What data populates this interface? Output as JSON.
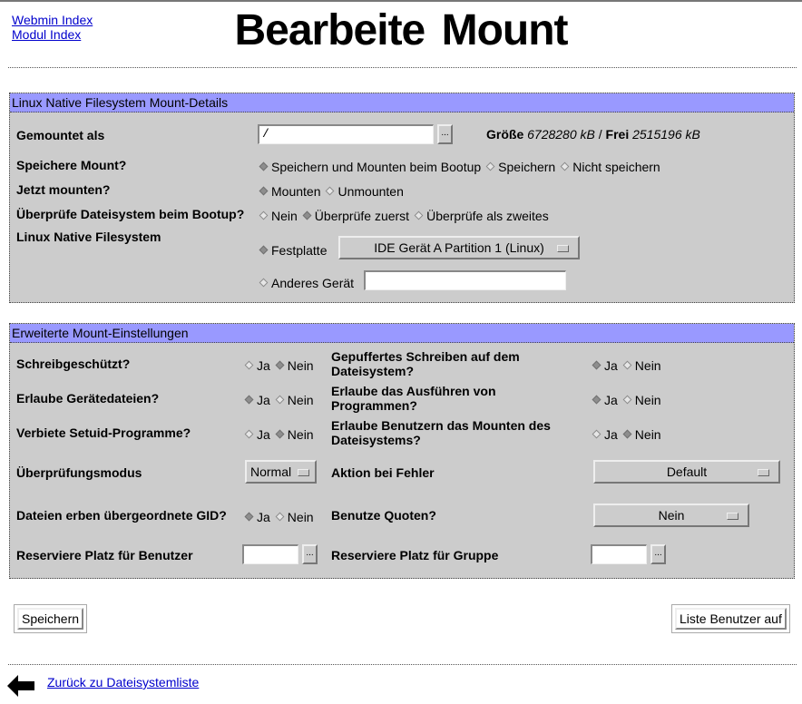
{
  "nav": {
    "webmin_index": "Webmin Index",
    "module_index": "Modul Index"
  },
  "page_title": "Bearbeite Mount",
  "section1": {
    "title": "Linux Native Filesystem Mount-Details",
    "mounted_as": {
      "label": "Gemountet als",
      "value": "/",
      "browse": "..."
    },
    "size": {
      "size_label": "Größe",
      "size_value": "6728280 kB",
      "sep": "/",
      "free_label": "Frei",
      "free_value": "2515196 kB"
    },
    "save_mount": {
      "label": "Speichere Mount?",
      "options": [
        "Speichern und Mounten beim Bootup",
        "Speichern",
        "Nicht speichern"
      ],
      "selected": 0
    },
    "mount_now": {
      "label": "Jetzt mounten?",
      "options": [
        "Mounten",
        "Unmounten"
      ],
      "selected": 0
    },
    "check_fs": {
      "label": "Überprüfe Dateisystem beim Bootup?",
      "options": [
        "Nein",
        "Überprüfe zuerst",
        "Überprüfe als zweites"
      ],
      "selected": 1
    },
    "fs": {
      "label": "Linux Native Filesystem",
      "disk_label": "Festplatte",
      "disk_selected": true,
      "disk_value": "IDE Gerät A Partition 1 (Linux)",
      "other_label": "Anderes Gerät",
      "other_value": ""
    }
  },
  "section2": {
    "title": "Erweiterte Mount-Einstellungen",
    "ro": {
      "label": "Schreibgeschützt?",
      "options": [
        "Ja",
        "Nein"
      ],
      "selected": 1
    },
    "sync": {
      "label": "Gepuffertes Schreiben auf dem Dateisystem?",
      "options": [
        "Ja",
        "Nein"
      ],
      "selected": 0
    },
    "dev": {
      "label": "Erlaube Gerätedateien?",
      "options": [
        "Ja",
        "Nein"
      ],
      "selected": 0
    },
    "exec": {
      "label": "Erlaube das Ausführen von Programmen?",
      "options": [
        "Ja",
        "Nein"
      ],
      "selected": 0
    },
    "suid": {
      "label": "Verbiete Setuid-Programme?",
      "options": [
        "Ja",
        "Nein"
      ],
      "selected": 1
    },
    "user": {
      "label": "Erlaube Benutzern das Mounten des Dateisystems?",
      "options": [
        "Ja",
        "Nein"
      ],
      "selected": 1
    },
    "check_mode": {
      "label": "Überprüfungsmodus",
      "value": "Normal"
    },
    "errors": {
      "label": "Aktion bei Fehler",
      "value": "Default"
    },
    "grpid": {
      "label": "Dateien erben übergeordnete GID?",
      "options": [
        "Ja",
        "Nein"
      ],
      "selected": 0
    },
    "quota": {
      "label": "Benutze Quoten?",
      "value": "Nein"
    },
    "resuid": {
      "label": "Reserviere Platz für Benutzer",
      "value": "",
      "browse": "..."
    },
    "resgid": {
      "label": "Reserviere Platz für Gruppe",
      "value": "",
      "browse": "..."
    }
  },
  "buttons": {
    "save": "Speichern",
    "list_users": "Liste Benutzer auf"
  },
  "footer": {
    "back_link": "Zurück zu Dateisystemliste"
  }
}
